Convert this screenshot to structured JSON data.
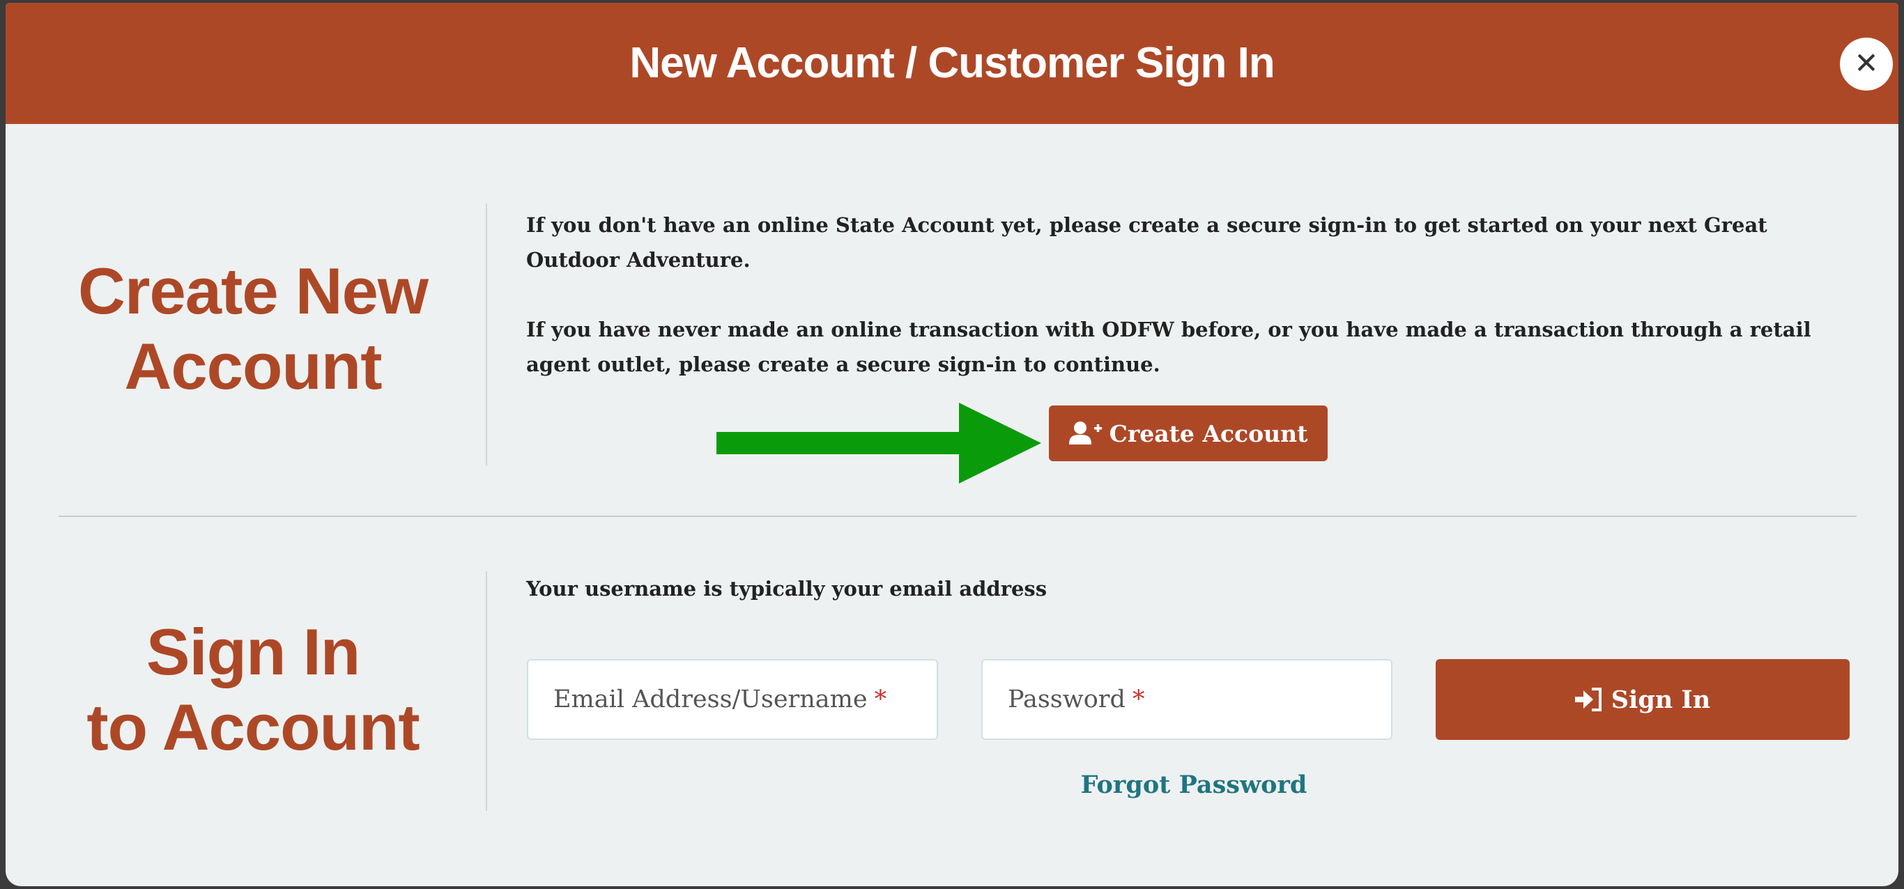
{
  "header": {
    "title": "New Account / Customer Sign In",
    "close_icon": "close-icon"
  },
  "create_section": {
    "heading_line1": "Create New",
    "heading_line2": "Account",
    "paragraph1": "If you don't have an online State Account yet, please create a secure sign-in to get started on your next Great Outdoor Adventure.",
    "paragraph2": "If you have never made an online transaction with ODFW before, or you have made a transaction through a retail agent outlet, please create a secure sign-in to continue.",
    "button_label": "Create Account",
    "button_icon": "user-plus-icon",
    "annotation_arrow_color": "#0a9b0a"
  },
  "signin_section": {
    "heading_line1": "Sign In",
    "heading_line2": "to Account",
    "hint": "Your username is typically your email address",
    "username_placeholder": "Email Address/Username",
    "password_placeholder": "Password",
    "required_marker": "*",
    "button_label": "Sign In",
    "button_icon": "sign-in-icon",
    "forgot_label": "Forgot Password"
  },
  "colors": {
    "brand": "#ad4827",
    "background": "#eef1f1",
    "link": "#1f7580",
    "required": "#c9302c"
  }
}
